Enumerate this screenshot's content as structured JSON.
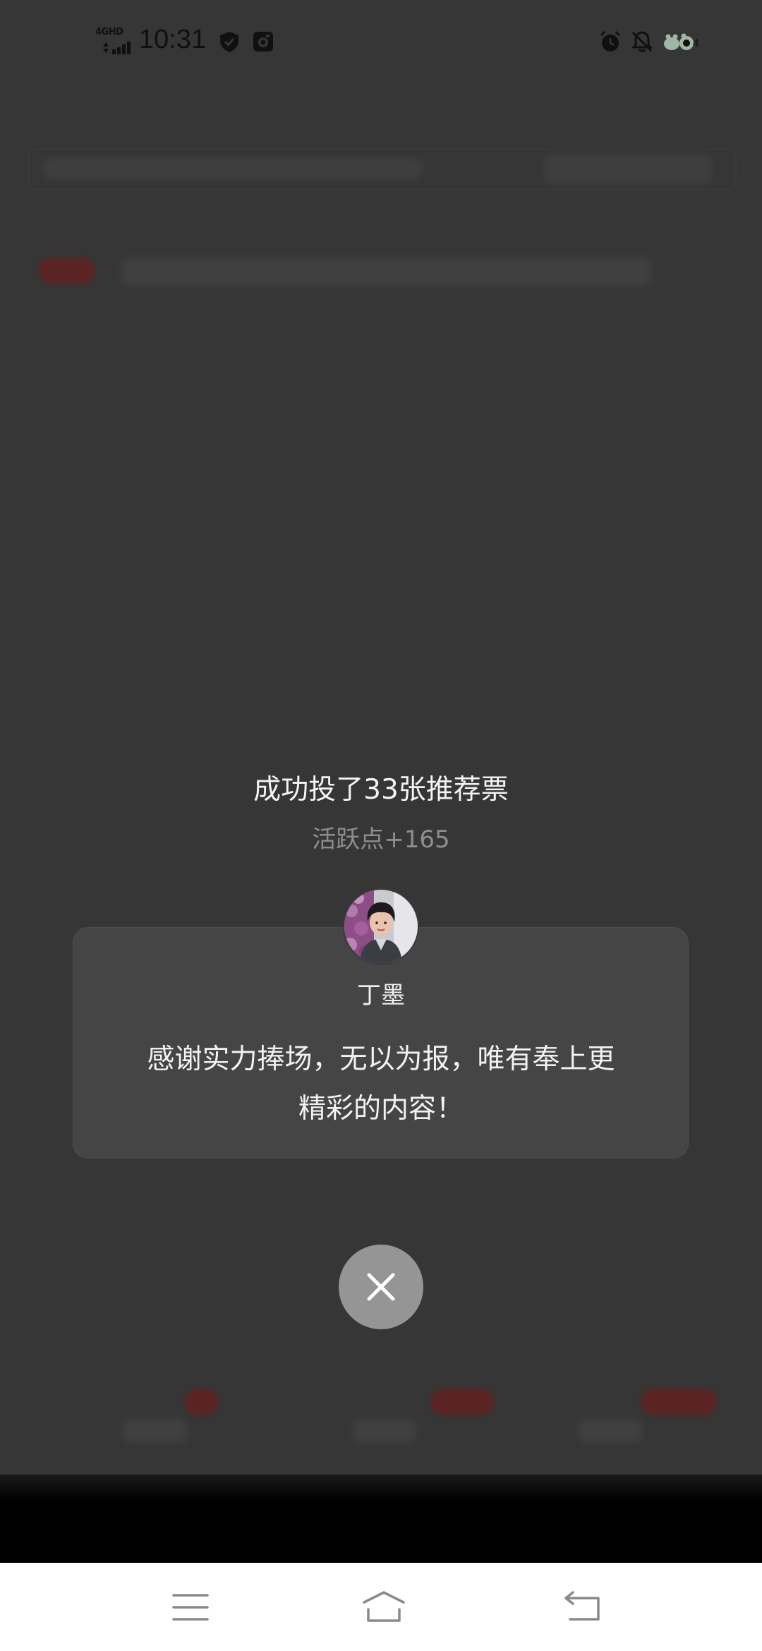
{
  "status_bar": {
    "time": "10:31",
    "network": "4GHD",
    "icons": [
      "signal-icon",
      "shield-icon",
      "gallery-icon",
      "alarm-icon",
      "bell-off-icon",
      "battery-icon"
    ]
  },
  "dialog": {
    "title": "成功投了33张推荐票",
    "subtitle": "活跃点+165",
    "author_name": "丁墨",
    "thanks_line_1": "感谢实力捧场，无以为报，唯有奉上更",
    "thanks_line_2": "精彩的内容！",
    "close_icon": "close-icon"
  },
  "nav_bar": {
    "items": [
      "menu-icon",
      "home-icon",
      "back-icon"
    ]
  },
  "colors": {
    "overlay_bg": "#363636",
    "card_bg": "#454545",
    "close_bg": "#959595",
    "subtitle": "#8e8e8e",
    "nav_bg": "#ffffff"
  }
}
